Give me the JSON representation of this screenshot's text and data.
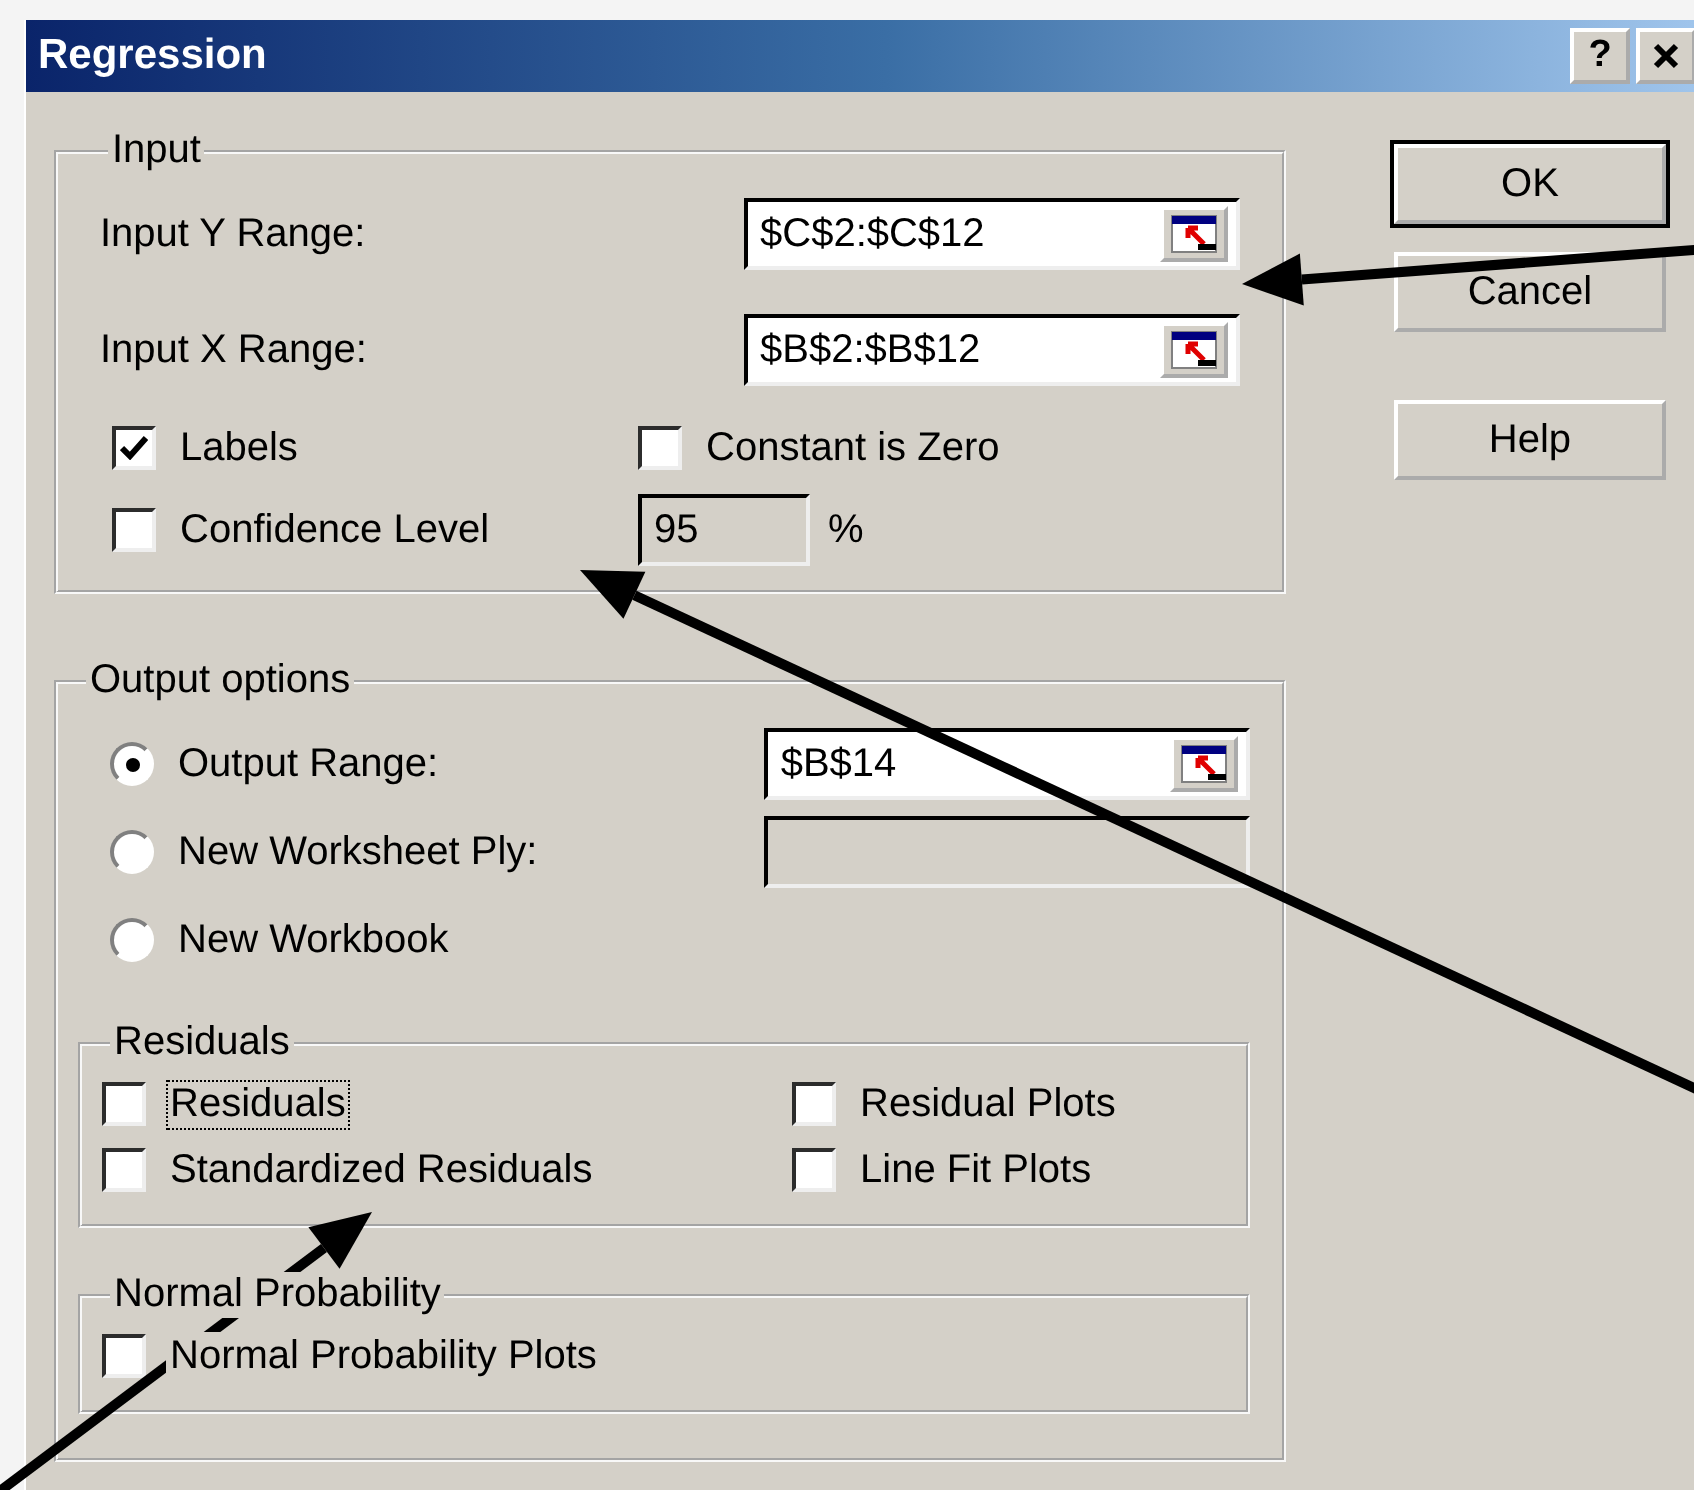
{
  "window": {
    "title": "Regression",
    "help_glyph": "?"
  },
  "input": {
    "title": "Input",
    "ranges": [
      {
        "label": "Input Y Range:",
        "value": "$C$2:$C$12"
      },
      {
        "label": "Input X Range:",
        "value": "$B$2:$B$12"
      }
    ],
    "options": [
      {
        "label": "Labels",
        "checked": true
      },
      {
        "label": "Constant is Zero",
        "checked": false
      }
    ],
    "confidence": {
      "label": "Confidence Level",
      "checked": false,
      "value": "95",
      "disabled": true,
      "unit": "%"
    }
  },
  "output": {
    "title": "Output options",
    "destinations": [
      {
        "label": "Output Range:",
        "selected": true,
        "field": {
          "value": "$B$14",
          "disabled": false
        }
      },
      {
        "label": "New Worksheet Ply:",
        "selected": false,
        "field": {
          "disabled": true
        }
      },
      {
        "label": "New Workbook",
        "selected": false
      }
    ],
    "residuals": {
      "title": "Residuals",
      "options": [
        {
          "label": "Residuals",
          "checked": false,
          "focused": true
        },
        {
          "label": "Residual Plots",
          "checked": false,
          "focused": false
        },
        {
          "label": "Standardized Residuals",
          "checked": false,
          "focused": false
        },
        {
          "label": "Line Fit Plots",
          "checked": false,
          "focused": false
        }
      ]
    },
    "normal": {
      "title": "Normal Probability",
      "options": [
        {
          "label": "Normal Probability Plots",
          "checked": false,
          "focused": false
        }
      ]
    }
  },
  "buttons": [
    {
      "label": "OK",
      "default": true
    },
    {
      "label": "Cancel",
      "default": false
    },
    {
      "label": "Help",
      "default": false
    }
  ]
}
